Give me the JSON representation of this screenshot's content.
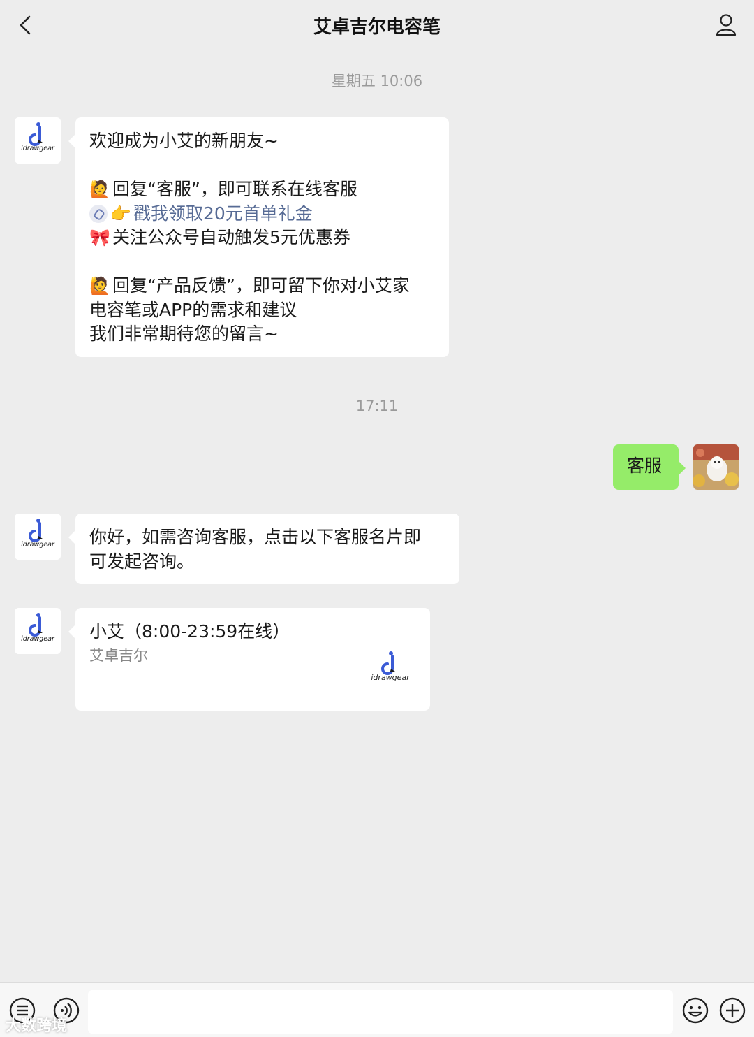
{
  "header": {
    "title": "艾卓吉尔电容笔",
    "back_icon": "chevron-left-icon",
    "profile_icon": "person-icon"
  },
  "timestamps": [
    "星期五 10:06",
    "17:11"
  ],
  "messages": {
    "welcome": {
      "lines": [
        {
          "text": "欢迎成为小艾的新朋友~"
        },
        {
          "text": ""
        },
        {
          "emoji": "🙋",
          "text": "回复“客服”，即可联系在线客服"
        },
        {
          "emoji": "👉",
          "text": "戳我领取20元首单礼金",
          "link": true
        },
        {
          "emoji": "🎀",
          "text": "关注公众号自动触发5元优惠券"
        },
        {
          "text": ""
        },
        {
          "emoji": "🙋",
          "text": "回复“产品反馈”，即可留下你对小艾家"
        },
        {
          "text": "电容笔或APP的需求和建议"
        },
        {
          "text": "我们非常期待您的留言~"
        }
      ]
    },
    "user_reply": {
      "text": "客服"
    },
    "service_reply": {
      "lines": [
        "你好，如需咨询客服，点击以下客服名片即",
        "可发起咨询。"
      ]
    },
    "contact_card": {
      "name": "小艾（8:00-23:59在线）",
      "company": "艾卓吉尔"
    }
  },
  "brand": {
    "logo_text": "idrawgear",
    "accent": "#3b5bd6"
  },
  "colors": {
    "background": "#ededed",
    "self_bubble": "#95ec69",
    "link": "#576b95"
  },
  "bottom_bar": {
    "icons": [
      "menu-icon",
      "voice-icon",
      "emoji-icon",
      "plus-icon"
    ],
    "input_placeholder": ""
  },
  "watermark": "大数跨境"
}
